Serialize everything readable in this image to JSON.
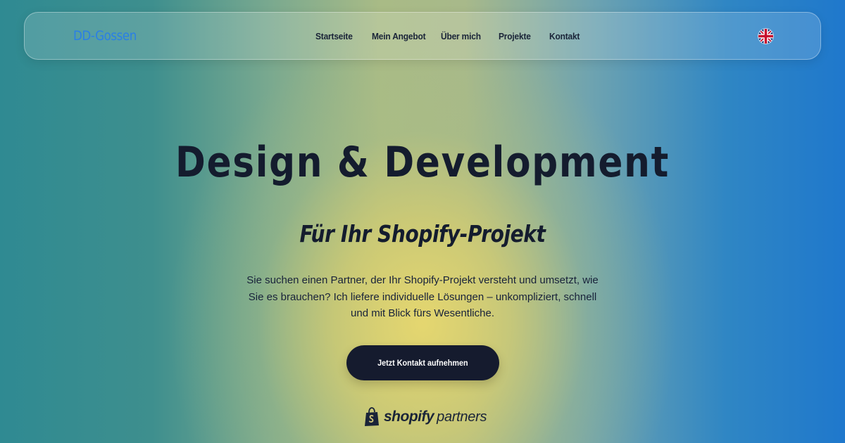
{
  "header": {
    "logo": "DD-Gossen",
    "nav": [
      {
        "label": "Startseite"
      },
      {
        "label": "Mein Angebot"
      },
      {
        "label": "Über mich"
      },
      {
        "label": "Projekte"
      },
      {
        "label": "Kontakt"
      }
    ],
    "language_icon": "uk-flag-icon"
  },
  "hero": {
    "headline": "Design & Development",
    "subheadline": "Für Ihr Shopify-Projekt",
    "intro": "Sie suchen einen Partner, der Ihr Shopify-Projekt versteht und umsetzt, wie Sie es brauchen? Ich liefere individuelle Lösungen – unkompliziert, schnell und mit Blick fürs Wesentliche.",
    "cta_label": "Jetzt Kontakt aufnehmen"
  },
  "partner_badge": {
    "icon": "shopify-bag-icon",
    "brand": "shopify",
    "suffix": "partners"
  },
  "colors": {
    "logo": "#2a7fe6",
    "text_dark": "#141c2e",
    "button_bg": "#151b2e",
    "button_text": "#ffffff",
    "gradient_left": "#2f8a92",
    "gradient_center": "#e8d86e",
    "gradient_right": "#1f78cc"
  }
}
